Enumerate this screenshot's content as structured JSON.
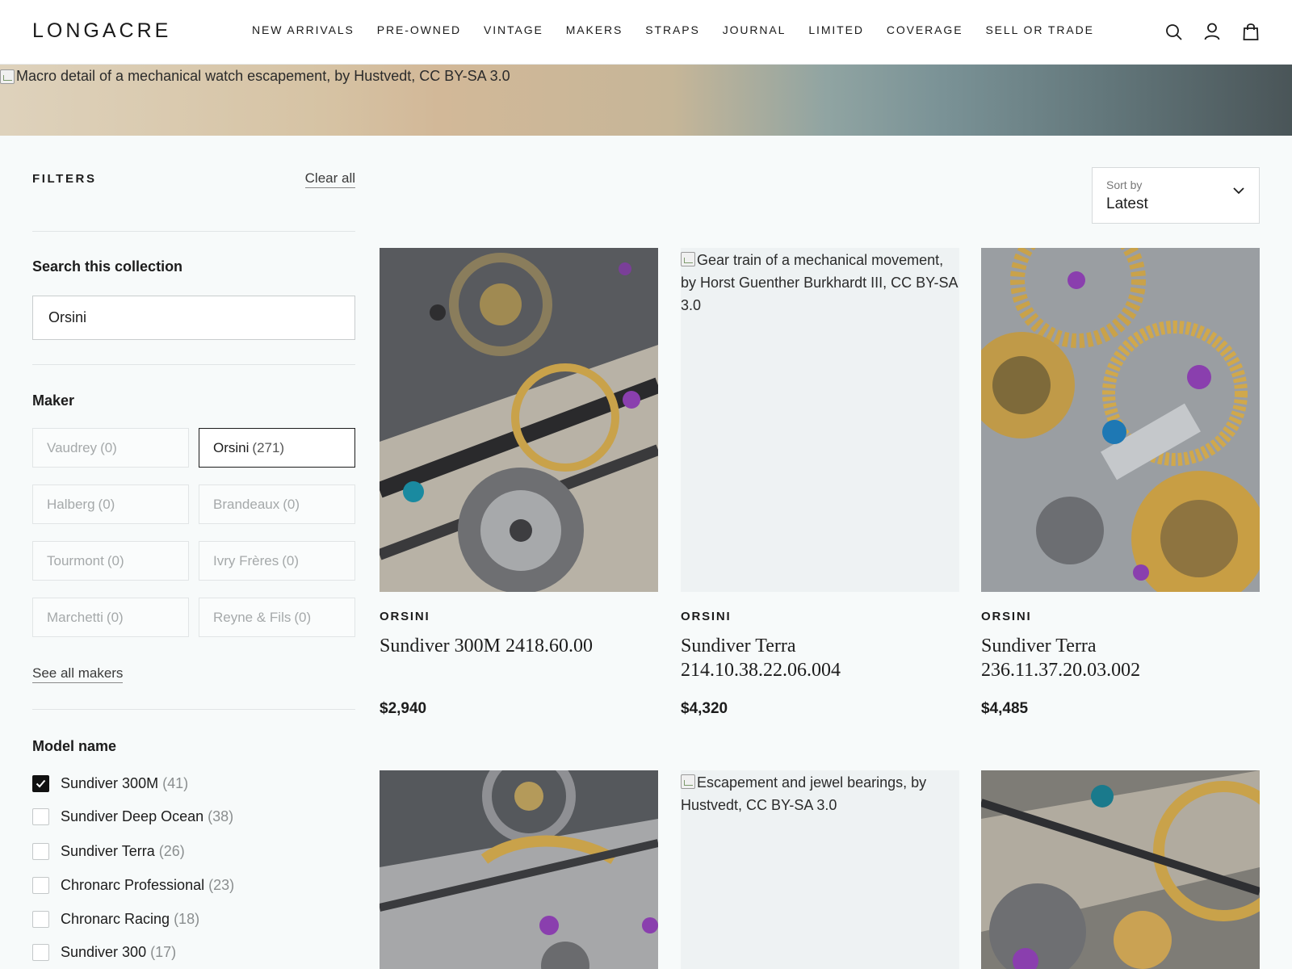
{
  "header": {
    "logo": "LONGACRE",
    "nav": [
      "NEW ARRIVALS",
      "PRE-OWNED",
      "VINTAGE",
      "MAKERS",
      "STRAPS",
      "JOURNAL",
      "LIMITED",
      "COVERAGE",
      "SELL OR TRADE"
    ],
    "icons": [
      "search-icon",
      "account-icon",
      "bag-icon"
    ]
  },
  "banner": {
    "alt": "Macro detail of a mechanical watch escapement, by Hustvedt, CC BY-SA 3.0"
  },
  "filters": {
    "title": "FILTERS",
    "clear_all": "Clear all",
    "search": {
      "label": "Search this collection",
      "value": "Orsini"
    },
    "maker": {
      "label": "Maker",
      "options": [
        {
          "name": "Vaudrey",
          "count": "(0)",
          "selected": false
        },
        {
          "name": "Orsini",
          "count": "(271)",
          "selected": true
        },
        {
          "name": "Halberg",
          "count": "(0)",
          "selected": false
        },
        {
          "name": "Brandeaux",
          "count": "(0)",
          "selected": false
        },
        {
          "name": "Tourmont",
          "count": "(0)",
          "selected": false
        },
        {
          "name": "Ivry Frères",
          "count": "(0)",
          "selected": false
        },
        {
          "name": "Marchetti",
          "count": "(0)",
          "selected": false
        },
        {
          "name": "Reyne & Fils",
          "count": "(0)",
          "selected": false
        }
      ],
      "see_all": "See all makers"
    },
    "model": {
      "label": "Model name",
      "options": [
        {
          "name": "Sundiver 300M",
          "count": "(41)",
          "checked": true
        },
        {
          "name": "Sundiver Deep Ocean",
          "count": "(38)",
          "checked": false
        },
        {
          "name": "Sundiver Terra",
          "count": "(26)",
          "checked": false
        },
        {
          "name": "Chronarc Professional",
          "count": "(23)",
          "checked": false
        },
        {
          "name": "Chronarc Racing",
          "count": "(18)",
          "checked": false
        },
        {
          "name": "Sundiver 300",
          "count": "(17)",
          "checked": false
        }
      ]
    }
  },
  "sort": {
    "label": "Sort by",
    "value": "Latest"
  },
  "products": [
    {
      "brand": "ORSINI",
      "title": "Sundiver 300M 2418.60.00",
      "price": "$2,940",
      "image_alt": ""
    },
    {
      "brand": "ORSINI",
      "title": "Sundiver Terra 214.10.38.22.06.004",
      "price": "$4,320",
      "image_alt": "Gear train of a mechanical movement, by Horst Guenther Burkhardt III, CC BY-SA 3.0"
    },
    {
      "brand": "ORSINI",
      "title": "Sundiver Terra 236.11.37.20.03.002",
      "price": "$4,485",
      "image_alt": ""
    },
    {
      "brand": "",
      "title": "",
      "price": "",
      "image_alt": ""
    },
    {
      "brand": "",
      "title": "",
      "price": "",
      "image_alt": "Escapement and jewel bearings, by Hustvedt, CC BY-SA 3.0"
    },
    {
      "brand": "",
      "title": "",
      "price": "",
      "image_alt": ""
    }
  ],
  "colors": {
    "background": "#f7fafa",
    "text": "#1c1c1c",
    "muted": "#a5a9aa",
    "brass": "#c9a24a",
    "jewel": "#8a3fae"
  }
}
